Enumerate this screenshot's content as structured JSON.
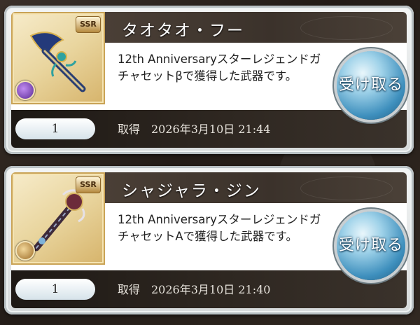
{
  "items": [
    {
      "name": "タオタオ・フー",
      "rarity": "SSR",
      "element_icon": "dark-element-icon",
      "description": "12th Anniversaryスターレジェンドガチャセットβで獲得した武器です。",
      "quantity": "1",
      "acquired_label": "取得",
      "acquired_datetime": "2026年3月10日 21:44",
      "receive_label": "受け取る"
    },
    {
      "name": "シャジャラ・ジン",
      "rarity": "SSR",
      "element_icon": "earth-element-icon",
      "description": "12th AnniversaryスターレジェンドガチャセットAで獲得した武器です。",
      "quantity": "1",
      "acquired_label": "取得",
      "acquired_datetime": "2026年3月10日 21:40",
      "receive_label": "受け取る"
    }
  ],
  "colors": {
    "title_bar": "#3b322b",
    "footer_bar": "#2d2620",
    "receive_button": "#3e8fbd",
    "card_frame": "#b9c1c4"
  }
}
